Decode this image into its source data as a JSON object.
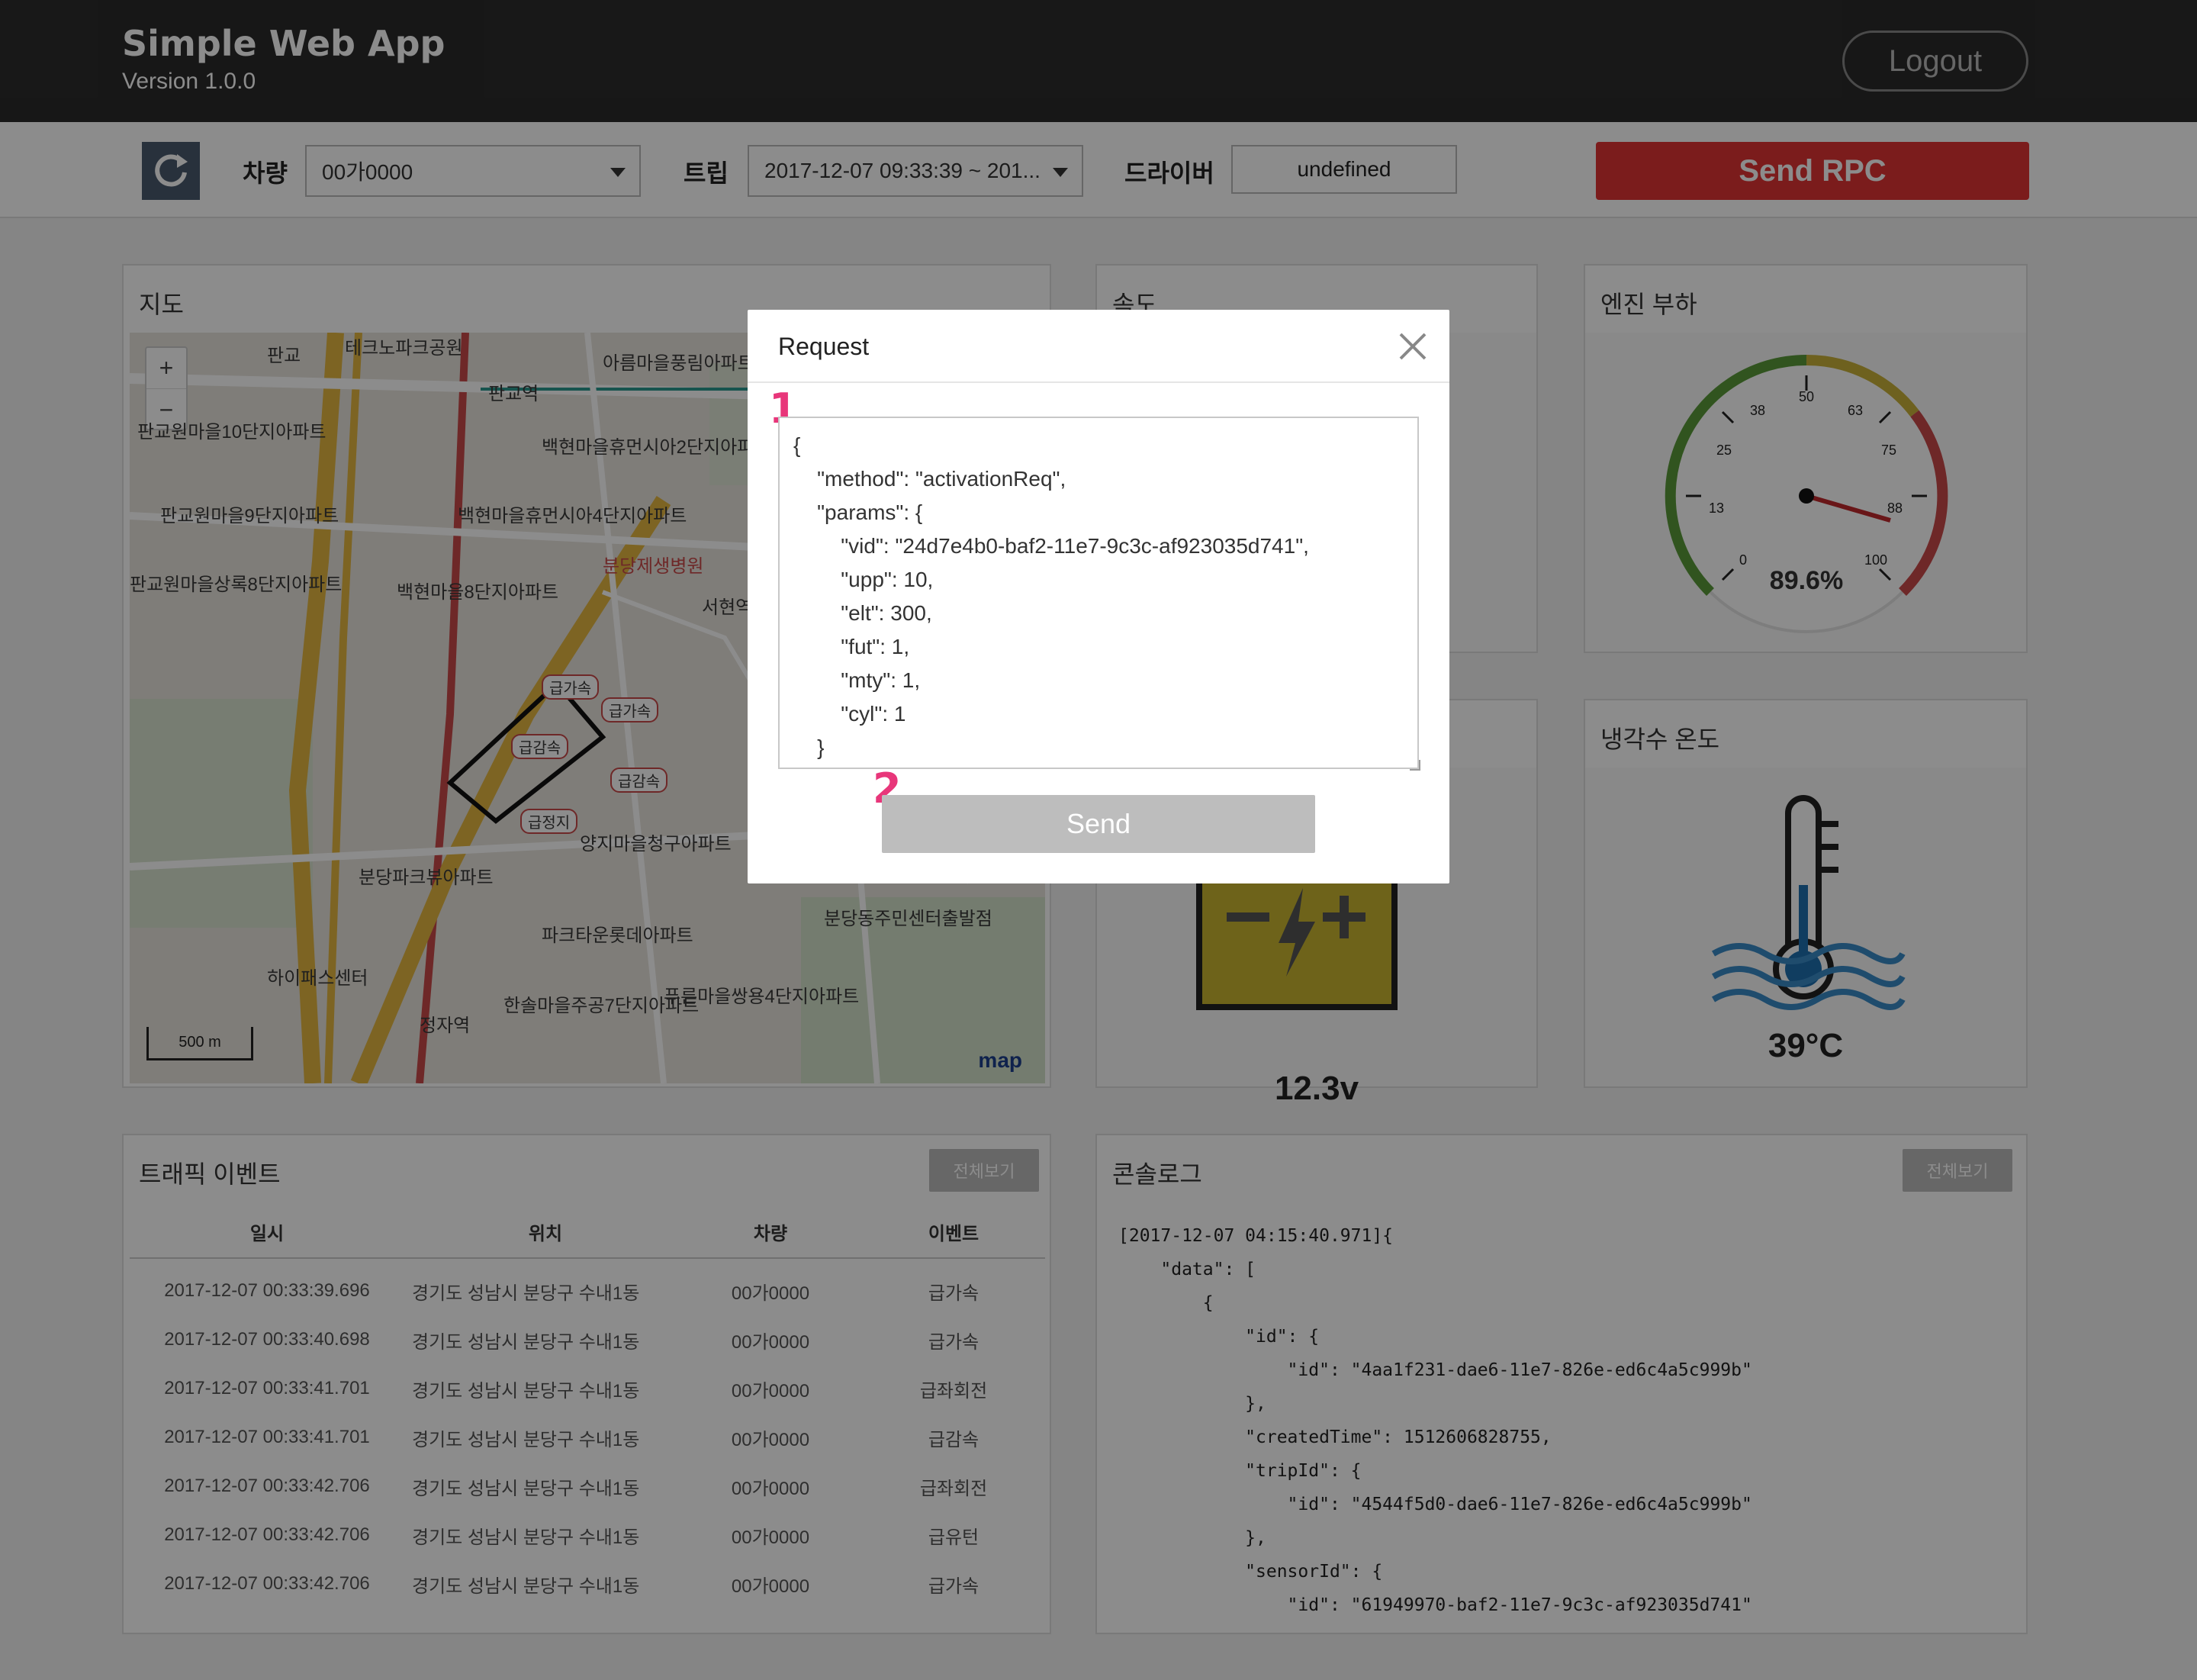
{
  "header": {
    "app_title": "Simple Web App",
    "version": "Version 1.0.0",
    "logout_label": "Logout"
  },
  "toolbar": {
    "vehicle_label": "차량",
    "vehicle_value": "00가0000",
    "trip_label": "트립",
    "trip_value": "2017-12-07 09:33:39 ~ 201...",
    "driver_label": "드라이버",
    "driver_value": "undefined",
    "send_rpc_label": "Send RPC"
  },
  "map_panel": {
    "title": "지도",
    "zoom_in": "+",
    "zoom_out": "−",
    "scale_label": "500 m",
    "logo": "map",
    "labels": [
      "판교",
      "테크노파크공원",
      "판교역",
      "아름마을풍림아파트",
      "판교원마을10단지아파트",
      "백현마을휴먼시아2단지아파트",
      "판교원마을9단지아파트",
      "백현마을휴먼시아4단지아파트",
      "분당제생병원",
      "판교원마을상록8단지아파트",
      "백현마을8단지아파트",
      "서현역",
      "양지마을청구아파트",
      "분당파크뷰아파트",
      "파크타운롯데아파트",
      "분당동주민센터출발점",
      "하이패스센터",
      "한솔마을주공7단지아파트",
      "푸른마을쌍용4단지아파트",
      "정자역",
      "급가속",
      "급감속",
      "급정지"
    ]
  },
  "speed_panel": {
    "title": "속도"
  },
  "engine_panel": {
    "title": "엔진 부하",
    "value": "89.6%",
    "ticks": [
      "0",
      "13",
      "25",
      "38",
      "50",
      "63",
      "75",
      "88",
      "100"
    ]
  },
  "battery_panel": {
    "value": "12.3v"
  },
  "coolant_panel": {
    "title": "냉각수 온도",
    "value": "39°C"
  },
  "traffic_panel": {
    "title": "트래픽 이벤트",
    "view_all": "전체보기",
    "columns": [
      "일시",
      "위치",
      "차량",
      "이벤트"
    ],
    "rows": [
      [
        "2017-12-07 00:33:39.696",
        "경기도 성남시 분당구 수내1동",
        "00가0000",
        "급가속"
      ],
      [
        "2017-12-07 00:33:40.698",
        "경기도 성남시 분당구 수내1동",
        "00가0000",
        "급가속"
      ],
      [
        "2017-12-07 00:33:41.701",
        "경기도 성남시 분당구 수내1동",
        "00가0000",
        "급좌회전"
      ],
      [
        "2017-12-07 00:33:41.701",
        "경기도 성남시 분당구 수내1동",
        "00가0000",
        "급감속"
      ],
      [
        "2017-12-07 00:33:42.706",
        "경기도 성남시 분당구 수내1동",
        "00가0000",
        "급좌회전"
      ],
      [
        "2017-12-07 00:33:42.706",
        "경기도 성남시 분당구 수내1동",
        "00가0000",
        "급유턴"
      ],
      [
        "2017-12-07 00:33:42.706",
        "경기도 성남시 분당구 수내1동",
        "00가0000",
        "급가속"
      ]
    ]
  },
  "console_panel": {
    "title": "콘솔로그",
    "view_all": "전체보기",
    "text": "[2017-12-07 04:15:40.971]{\n    \"data\": [\n        {\n            \"id\": {\n                \"id\": \"4aa1f231-dae6-11e7-826e-ed6c4a5c999b\"\n            },\n            \"createdTime\": 1512606828755,\n            \"tripId\": {\n                \"id\": \"4544f5d0-dae6-11e7-826e-ed6c4a5c999b\"\n            },\n            \"sensorId\": {\n                \"id\": \"61949970-baf2-11e7-9c3c-af923035d741\""
  },
  "modal": {
    "title": "Request",
    "json_text": "{\n    \"method\": \"activationReq\",\n    \"params\": {\n        \"vid\": \"24d7e4b0-baf2-11e7-9c3c-af923035d741\",\n        \"upp\": 10,\n        \"elt\": 300,\n        \"fut\": 1,\n        \"mty\": 1,\n        \"cyl\": 1\n    }",
    "send_label": "Send",
    "step1": "1",
    "step2": "2"
  },
  "colors": {
    "header_bg": "#2b2b2b",
    "send_rpc": "#e03333",
    "step_badge": "#e8367a",
    "needle": "#c0282d"
  }
}
